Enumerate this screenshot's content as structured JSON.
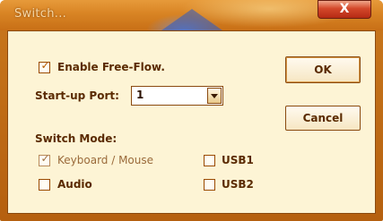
{
  "window": {
    "title": "Switch...",
    "close_glyph": "X"
  },
  "options": {
    "free_flow": {
      "label": "Enable Free-Flow.",
      "checked": true
    },
    "startup_port": {
      "label": "Start-up Port:",
      "value": "1"
    }
  },
  "buttons": {
    "ok": "OK",
    "cancel": "Cancel"
  },
  "switch_mode": {
    "heading": "Switch Mode:",
    "keyboard_mouse": {
      "label": "Keyboard / Mouse",
      "checked": true,
      "enabled": false
    },
    "usb1": {
      "label": "USB1",
      "checked": false
    },
    "audio": {
      "label": "Audio",
      "checked": false
    },
    "usb2": {
      "label": "USB2",
      "checked": false
    }
  },
  "icons": {
    "check": "✓",
    "dropdown": "chevron-down-icon",
    "close": "close-icon"
  },
  "colors": {
    "frame": "#c9781d",
    "client_bg": "#fdf4d5",
    "text": "#5a2a00",
    "close_button": "#d4482a"
  }
}
